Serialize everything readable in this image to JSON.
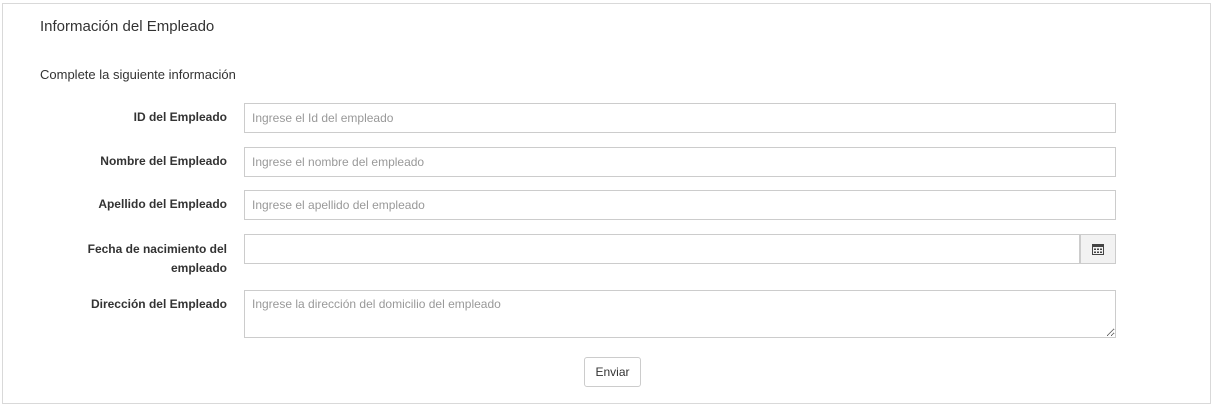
{
  "card": {
    "title": "Información del Empleado",
    "subtitle": "Complete la siguiente información"
  },
  "fields": {
    "id": {
      "label": "ID del Empleado",
      "placeholder": "Ingrese el Id del empleado",
      "value": ""
    },
    "nombre": {
      "label": "Nombre del Empleado",
      "placeholder": "Ingrese el nombre del empleado",
      "value": ""
    },
    "apellido": {
      "label": "Apellido del Empleado",
      "placeholder": "Ingrese el apellido del empleado",
      "value": ""
    },
    "fecha": {
      "label_line1": "Fecha de nacimiento del",
      "label_line2": "empleado",
      "placeholder": "",
      "value": "",
      "icon": "calendar-icon"
    },
    "direccion": {
      "label": "Dirección del Empleado",
      "placeholder": "Ingrese la dirección del domicilio del empleado",
      "value": ""
    }
  },
  "actions": {
    "submit_label": "Enviar"
  }
}
